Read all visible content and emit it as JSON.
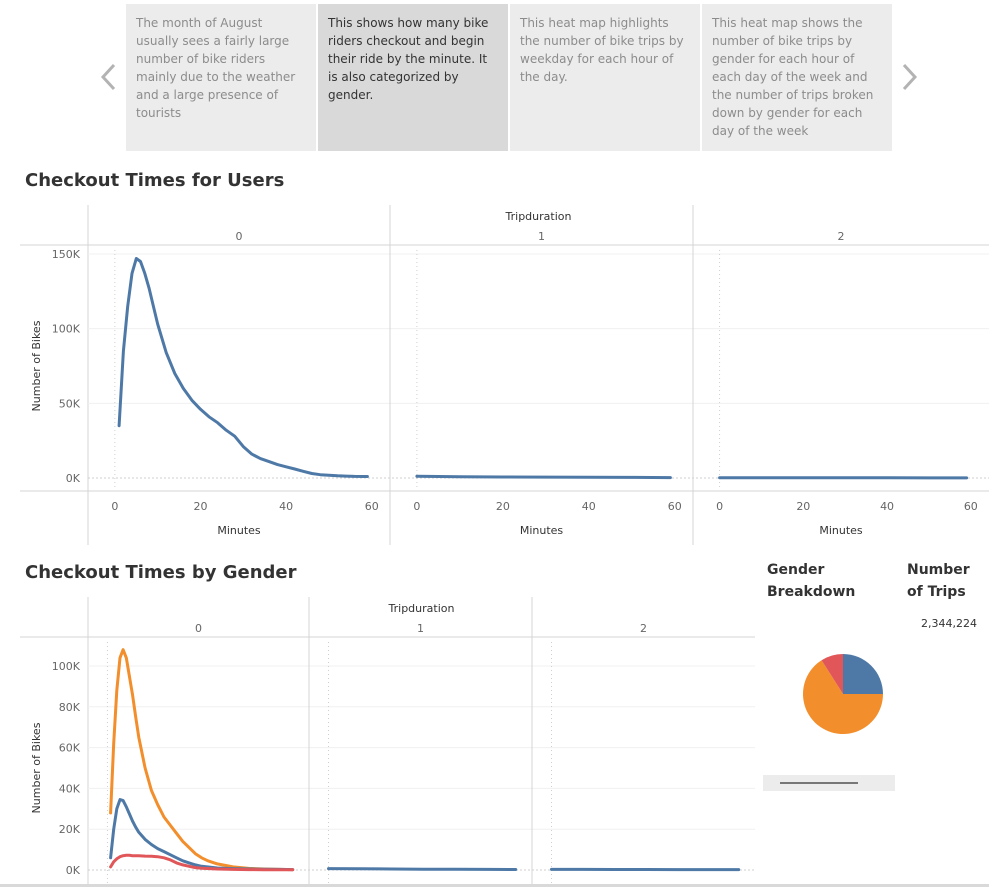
{
  "story": {
    "points": [
      {
        "text": "The month of August usually sees a fairly large number of bike riders mainly due to the weather and a large presence of tourists"
      },
      {
        "text": "This shows how many bike riders checkout and begin their ride by the minute. It is also categorized by gender."
      },
      {
        "text": "This heat map highlights the number of bike trips by weekday for each hour of the day."
      },
      {
        "text": "This heat map shows the number of bike trips by gender for each hour of each day of the week and the number of trips broken down by gender for each day of the week"
      }
    ],
    "active_index": 1,
    "prev_icon": "chevron-left-icon",
    "next_icon": "chevron-right-icon"
  },
  "users_chart": {
    "title": "Checkout Times for Users"
  },
  "gender_chart": {
    "title": "Checkout Times by Gender"
  },
  "side": {
    "gender_title": "Gender\nBreakdown",
    "trips_title": "Number\nof Trips",
    "trips_value": "2,344,224"
  },
  "colors": {
    "blue": "#4e79a7",
    "orange": "#f28e2b",
    "red": "#e15759",
    "grid": "#e6e6e6",
    "axis": "#d4d4d4"
  },
  "chart_data": [
    {
      "type": "line",
      "title": "Checkout Times for Users",
      "facet_label": "Tripduration",
      "facets": [
        "0",
        "1",
        "2"
      ],
      "xlabel": "Minutes",
      "ylabel": "Number of Bikes",
      "xticks": [
        0,
        20,
        40,
        60
      ],
      "yticks": [
        "0K",
        "50K",
        "100K",
        "150K"
      ],
      "ylim": [
        0,
        150000
      ],
      "xlim": [
        -3,
        61
      ],
      "panels": [
        {
          "facet": "0",
          "series": [
            {
              "color": "#4e79a7",
              "x": [
                1,
                2,
                3,
                4,
                5,
                6,
                7,
                8,
                9,
                10,
                12,
                14,
                16,
                18,
                20,
                22,
                24,
                26,
                28,
                30,
                32,
                34,
                36,
                38,
                40,
                42,
                44,
                46,
                48,
                50,
                52,
                54,
                56,
                58,
                59
              ],
              "y": [
                35000,
                85000,
                115000,
                137000,
                147000,
                145000,
                137000,
                127000,
                115000,
                103000,
                84000,
                70000,
                60000,
                52000,
                46000,
                41000,
                37000,
                32000,
                28000,
                21000,
                16000,
                13000,
                11000,
                9000,
                7500,
                6000,
                4500,
                3000,
                2200,
                1800,
                1500,
                1300,
                1100,
                1000,
                1000
              ]
            }
          ]
        },
        {
          "facet": "1",
          "series": [
            {
              "color": "#4e79a7",
              "x": [
                0,
                10,
                20,
                30,
                40,
                50,
                59
              ],
              "y": [
                1200,
                900,
                700,
                600,
                500,
                400,
                300
              ]
            }
          ]
        },
        {
          "facet": "2",
          "series": [
            {
              "color": "#4e79a7",
              "x": [
                0,
                10,
                20,
                30,
                40,
                50,
                59
              ],
              "y": [
                200,
                200,
                200,
                150,
                150,
                100,
                100
              ]
            }
          ]
        }
      ]
    },
    {
      "type": "line",
      "title": "Checkout Times by Gender",
      "facet_label": "Tripduration",
      "facets": [
        "0",
        "1",
        "2"
      ],
      "ylabel": "Number of Bikes",
      "yticks": [
        "0K",
        "20K",
        "40K",
        "60K",
        "80K",
        "100K"
      ],
      "ylim": [
        0,
        100000
      ],
      "xlim": [
        -3,
        61
      ],
      "panels": [
        {
          "facet": "0",
          "series": [
            {
              "color": "#f28e2b",
              "x": [
                1,
                2,
                3,
                4,
                5,
                6,
                7,
                8,
                9,
                10,
                12,
                14,
                16,
                18,
                20,
                22,
                24,
                26,
                28,
                30,
                32,
                35,
                40,
                45,
                50,
                55,
                59
              ],
              "y": [
                28000,
                62000,
                88000,
                104000,
                108000,
                104000,
                95000,
                86000,
                75000,
                65000,
                50000,
                39000,
                32000,
                26000,
                22000,
                18000,
                14000,
                11000,
                8000,
                6000,
                4500,
                3000,
                1500,
                800,
                500,
                300,
                200
              ]
            },
            {
              "color": "#4e79a7",
              "x": [
                1,
                2,
                3,
                4,
                5,
                6,
                7,
                8,
                9,
                10,
                12,
                14,
                16,
                18,
                20,
                22,
                24,
                26,
                28,
                30,
                35,
                40,
                45,
                50,
                55,
                59
              ],
              "y": [
                6000,
                20000,
                30000,
                34500,
                34000,
                31000,
                27500,
                24000,
                21000,
                18500,
                15000,
                12500,
                10500,
                9000,
                7500,
                6000,
                4500,
                3500,
                2500,
                1800,
                1000,
                700,
                500,
                400,
                300,
                200
              ]
            },
            {
              "color": "#e15759",
              "x": [
                1,
                2,
                3,
                4,
                5,
                6,
                7,
                8,
                10,
                12,
                14,
                16,
                18,
                20,
                22,
                24,
                26,
                28,
                30,
                35,
                40,
                45,
                50,
                55,
                59
              ],
              "y": [
                1500,
                4000,
                5500,
                6500,
                7000,
                7200,
                7200,
                7000,
                7000,
                6800,
                6700,
                6500,
                6000,
                5000,
                3500,
                2500,
                1800,
                1200,
                900,
                500,
                300,
                200,
                150,
                100,
                100
              ]
            }
          ]
        },
        {
          "facet": "1",
          "series": [
            {
              "color": "#4e79a7",
              "x": [
                0,
                10,
                20,
                30,
                40,
                50,
                59
              ],
              "y": [
                700,
                600,
                500,
                400,
                350,
                300,
                250
              ]
            }
          ]
        },
        {
          "facet": "2",
          "series": [
            {
              "color": "#4e79a7",
              "x": [
                0,
                10,
                20,
                30,
                40,
                50,
                59
              ],
              "y": [
                300,
                300,
                250,
                250,
                200,
                200,
                200
              ]
            }
          ]
        }
      ]
    },
    {
      "type": "pie",
      "title": "Gender Breakdown",
      "slices": [
        {
          "color": "#4e79a7",
          "value": 25
        },
        {
          "color": "#f28e2b",
          "value": 66
        },
        {
          "color": "#e15759",
          "value": 9
        }
      ]
    }
  ]
}
